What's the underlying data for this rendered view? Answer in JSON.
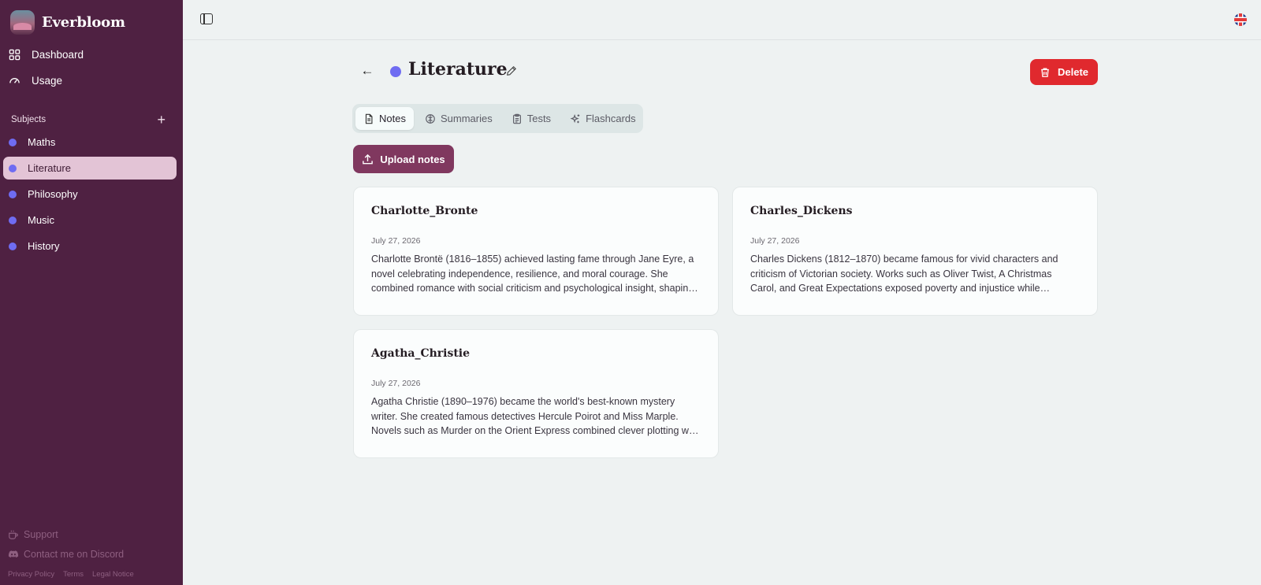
{
  "brand": {
    "name": "Everbloom"
  },
  "nav": [
    {
      "label": "Dashboard",
      "icon": "grid-icon"
    },
    {
      "label": "Usage",
      "icon": "gauge-icon"
    }
  ],
  "subjects_header": {
    "label": "Subjects",
    "add_icon": "plus-icon"
  },
  "subjects": [
    {
      "label": "Maths",
      "color": "#6f6cf2",
      "active": false
    },
    {
      "label": "Literature",
      "color": "#6f6cf2",
      "active": true
    },
    {
      "label": "Philosophy",
      "color": "#6f6cf2",
      "active": false
    },
    {
      "label": "Music",
      "color": "#6f6cf2",
      "active": false
    },
    {
      "label": "History",
      "color": "#6f6cf2",
      "active": false
    }
  ],
  "footer": {
    "support": "Support",
    "discord": "Contact me on Discord",
    "privacy": "Privacy Policy",
    "terms": "Terms",
    "legal": "Legal Notice"
  },
  "header": {
    "title": "Literature",
    "title_dot_color": "#6f6cf2",
    "delete_label": "Delete"
  },
  "tabs": [
    {
      "label": "Notes",
      "icon": "document-icon",
      "active": true
    },
    {
      "label": "Summaries",
      "icon": "brain-icon",
      "active": false
    },
    {
      "label": "Tests",
      "icon": "clipboard-icon",
      "active": false
    },
    {
      "label": "Flashcards",
      "icon": "sparkles-icon",
      "active": false
    }
  ],
  "upload": {
    "label": "Upload notes"
  },
  "notes": [
    {
      "title": "Charlotte_Bronte",
      "date": "July 27, 2026",
      "excerpt": "Charlotte Brontë (1816–1855) achieved lasting fame through Jane Eyre, a novel celebrating independence, resilience, and moral courage. She combined romance with social criticism and psychological insight, shaping later literature."
    },
    {
      "title": "Charles_Dickens",
      "date": "July 27, 2026",
      "excerpt": "Charles Dickens (1812–1870) became famous for vivid characters and criticism of Victorian society. Works such as Oliver Twist, A Christmas Carol, and Great Expectations exposed poverty and injustice while entertaining readers."
    },
    {
      "title": "Agatha_Christie",
      "date": "July 27, 2026",
      "excerpt": "Agatha Christie (1890–1976) became the world's best-known mystery writer. She created famous detectives Hercule Poirot and Miss Marple. Novels such as Murder on the Orient Express combined clever plotting with suspense."
    }
  ],
  "colors": {
    "sidebar_bg": "#4f2142",
    "accent": "#80385f",
    "danger": "#e0292e",
    "subject_dot": "#6f6cf2"
  }
}
